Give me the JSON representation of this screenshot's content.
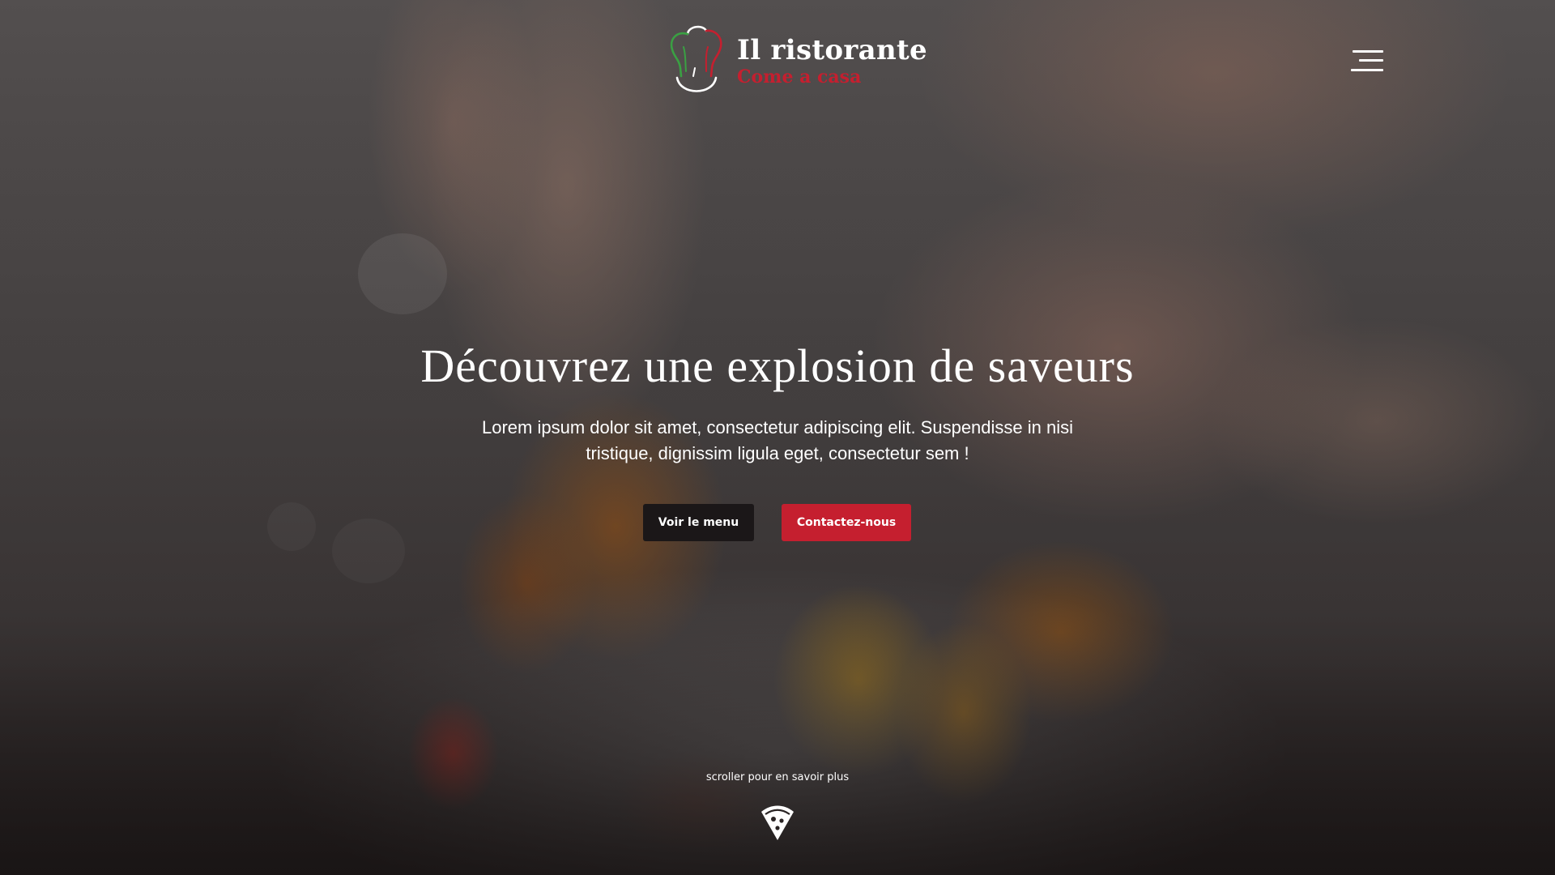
{
  "brand": {
    "title": "Il ristorante",
    "subtitle": "Come a casa",
    "colors": {
      "green": "#3aa043",
      "red": "#c51f2f",
      "white": "#ffffff"
    },
    "logo_icon": "chef-hat-icon"
  },
  "nav": {
    "menu_icon": "hamburger-menu-icon"
  },
  "hero": {
    "title": "Découvrez une explosion de saveurs",
    "text": "Lorem ipsum dolor sit amet, consectetur adipiscing elit. Suspendisse in nisi tristique, dignissim ligula eget, consectetur sem !",
    "buttons": {
      "menu_label": "Voir le menu",
      "contact_label": "Contactez-nous"
    },
    "button_colors": {
      "dark": "#1b1718",
      "red": "#c51f2f"
    }
  },
  "scroll": {
    "hint": "scroller pour en savoir plus",
    "icon": "pizza-slice-icon"
  }
}
